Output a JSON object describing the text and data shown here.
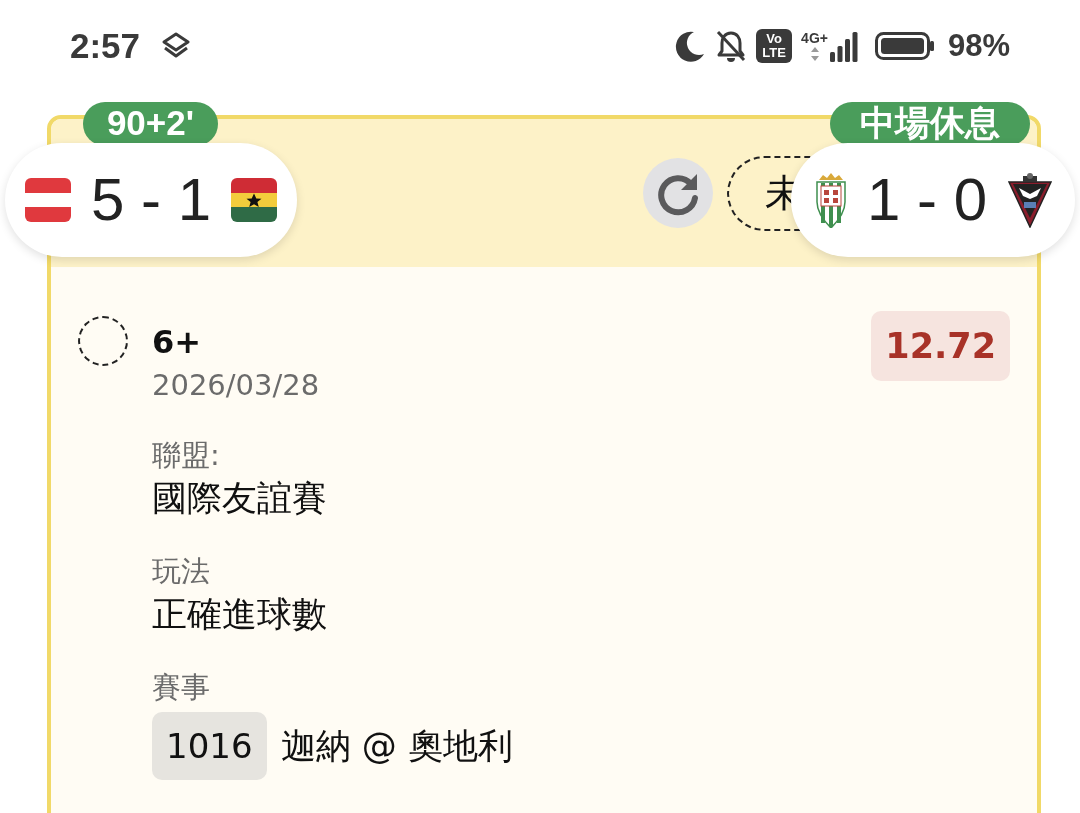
{
  "status_bar": {
    "time": "2:57",
    "volte": [
      "Vo",
      "LTE"
    ],
    "network": "4G+",
    "battery": "98%"
  },
  "header": {
    "status_tag": "未"
  },
  "live_scores": [
    {
      "minute": "90+2'",
      "score": "5 - 1"
    },
    {
      "minute": "中場休息",
      "score": "1 - 0"
    }
  ],
  "selection": {
    "selected": false,
    "label": "6+",
    "date": "2026/03/28",
    "odds": "12.72",
    "fields": [
      {
        "label": "聯盟:",
        "value": "國際友誼賽"
      },
      {
        "label": "玩法",
        "value": "正確進球數"
      },
      {
        "label": "賽事",
        "code": "1016",
        "value": "迦納 @ 奧地利"
      }
    ]
  }
}
